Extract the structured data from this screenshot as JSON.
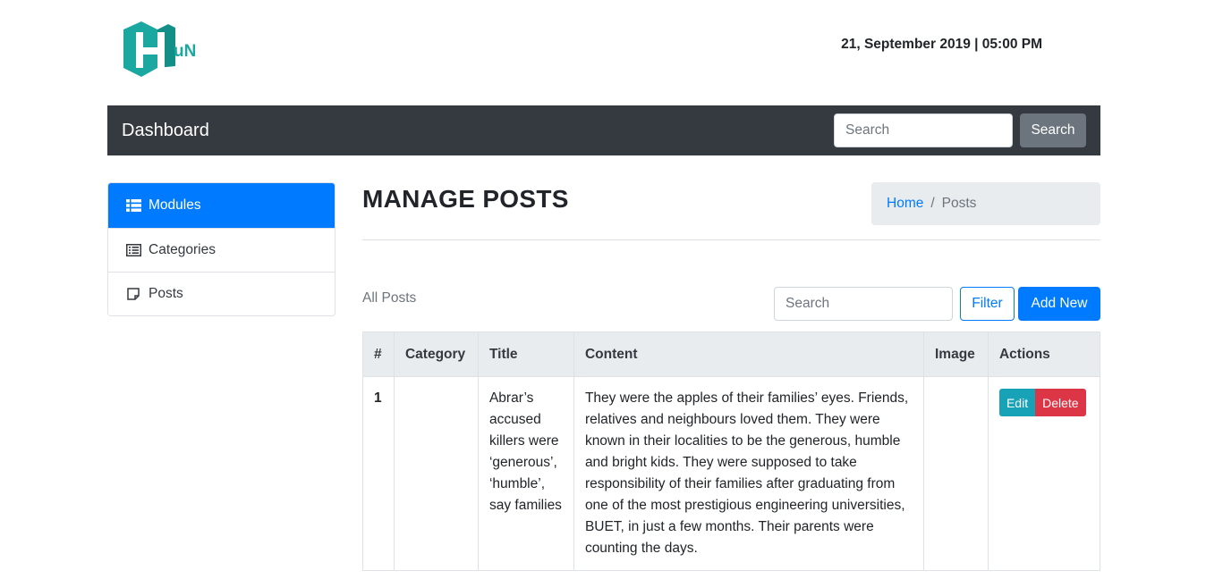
{
  "header": {
    "logo_text": "uN",
    "datetime": "21, September 2019 | 05:00 PM"
  },
  "navbar": {
    "brand": "Dashboard",
    "search_placeholder": "Search",
    "search_button": "Search"
  },
  "sidebar": {
    "items": [
      {
        "label": "Modules",
        "icon": "table-icon",
        "active": true
      },
      {
        "label": "Categories",
        "icon": "list-alt-icon",
        "active": false
      },
      {
        "label": "Posts",
        "icon": "sticky-note-icon",
        "active": false
      }
    ]
  },
  "main": {
    "title": "MANAGE POSTS",
    "breadcrumb": {
      "home": "Home",
      "separator": "/",
      "current": "Posts"
    },
    "section_label": "All Posts",
    "search_placeholder": "Search",
    "filter_button": "Filter",
    "add_button": "Add New"
  },
  "table": {
    "headers": [
      "#",
      "Category",
      "Title",
      "Content",
      "Image",
      "Actions"
    ],
    "rows": [
      {
        "num": "1",
        "category": "",
        "title": "Abrar’s accused killers were ‘generous’, ‘humble’, say families",
        "content": "They were the apples of their families’ eyes. Friends, relatives and neighbours loved them. They were known in their localities to be the generous, humble and bright kids. They were supposed to take responsibility of their families after graduating from one of the most prestigious engineering universities, BUET, in just a few months. Their parents were counting the days.",
        "image": "",
        "edit": "Edit",
        "delete": "Delete"
      }
    ]
  },
  "colors": {
    "navbar_bg": "#343a40",
    "primary": "#007bff",
    "info": "#17a2b8",
    "danger": "#dc3545",
    "secondary": "#6c757d",
    "logo": "#1aa8a0"
  }
}
